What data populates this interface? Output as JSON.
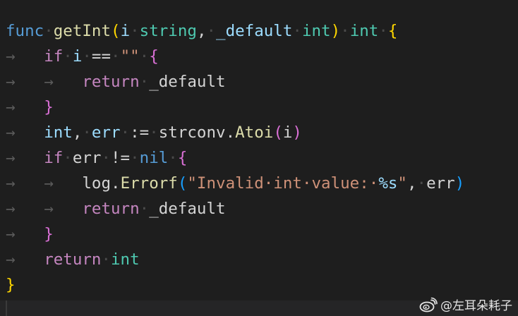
{
  "code": {
    "language": "go",
    "lines": [
      [
        {
          "t": "func",
          "c": "kw-func"
        },
        {
          "t": "·",
          "c": "ws"
        },
        {
          "t": "getInt",
          "c": "fn"
        },
        {
          "t": "(",
          "c": "brace-y"
        },
        {
          "t": "i",
          "c": "param"
        },
        {
          "t": "·",
          "c": "ws"
        },
        {
          "t": "string",
          "c": "type"
        },
        {
          "t": ",",
          "c": "punct"
        },
        {
          "t": "·",
          "c": "ws"
        },
        {
          "t": "_default",
          "c": "param"
        },
        {
          "t": "·",
          "c": "ws"
        },
        {
          "t": "int",
          "c": "type"
        },
        {
          "t": ")",
          "c": "brace-y"
        },
        {
          "t": "·",
          "c": "ws"
        },
        {
          "t": "int",
          "c": "type"
        },
        {
          "t": "·",
          "c": "ws"
        },
        {
          "t": "{",
          "c": "brace-y"
        }
      ],
      [
        {
          "t": "→   ",
          "c": "ind"
        },
        {
          "t": "if",
          "c": "ctrl"
        },
        {
          "t": "·",
          "c": "ws"
        },
        {
          "t": "i",
          "c": "param"
        },
        {
          "t": "·",
          "c": "ws"
        },
        {
          "t": "==",
          "c": "op"
        },
        {
          "t": "·",
          "c": "ws"
        },
        {
          "t": "\"\"",
          "c": "str"
        },
        {
          "t": "·",
          "c": "ws"
        },
        {
          "t": "{",
          "c": "brace-p"
        }
      ],
      [
        {
          "t": "→   ",
          "c": "ind"
        },
        {
          "t": "→   ",
          "c": "ind"
        },
        {
          "t": "return",
          "c": "ctrl"
        },
        {
          "t": "·",
          "c": "ws"
        },
        {
          "t": "_default",
          "c": "plain"
        }
      ],
      [
        {
          "t": "→   ",
          "c": "ind"
        },
        {
          "t": "}",
          "c": "brace-p"
        }
      ],
      [
        {
          "t": "→   ",
          "c": "ind"
        },
        {
          "t": "int",
          "c": "param"
        },
        {
          "t": ",",
          "c": "punct"
        },
        {
          "t": "·",
          "c": "ws"
        },
        {
          "t": "err",
          "c": "param"
        },
        {
          "t": "·",
          "c": "ws"
        },
        {
          "t": ":=",
          "c": "op"
        },
        {
          "t": "·",
          "c": "ws"
        },
        {
          "t": "strconv",
          "c": "plain"
        },
        {
          "t": ".",
          "c": "punct"
        },
        {
          "t": "Atoi",
          "c": "fn"
        },
        {
          "t": "(",
          "c": "brace-p"
        },
        {
          "t": "i",
          "c": "plain"
        },
        {
          "t": ")",
          "c": "brace-p"
        }
      ],
      [
        {
          "t": "→   ",
          "c": "ind"
        },
        {
          "t": "if",
          "c": "ctrl"
        },
        {
          "t": "·",
          "c": "ws"
        },
        {
          "t": "err",
          "c": "plain"
        },
        {
          "t": "·",
          "c": "ws"
        },
        {
          "t": "!=",
          "c": "op"
        },
        {
          "t": "·",
          "c": "ws"
        },
        {
          "t": "nil",
          "c": "lit"
        },
        {
          "t": "·",
          "c": "ws"
        },
        {
          "t": "{",
          "c": "brace-p"
        }
      ],
      [
        {
          "t": "→   ",
          "c": "ind"
        },
        {
          "t": "→   ",
          "c": "ind"
        },
        {
          "t": "log",
          "c": "plain"
        },
        {
          "t": ".",
          "c": "punct"
        },
        {
          "t": "Errorf",
          "c": "fn"
        },
        {
          "t": "(",
          "c": "brace-b"
        },
        {
          "t": "\"Invalid·int·value:·",
          "c": "str"
        },
        {
          "t": "%s",
          "c": "esc"
        },
        {
          "t": "\"",
          "c": "str"
        },
        {
          "t": ",",
          "c": "punct"
        },
        {
          "t": "·",
          "c": "ws"
        },
        {
          "t": "err",
          "c": "plain"
        },
        {
          "t": ")",
          "c": "brace-b"
        }
      ],
      [
        {
          "t": "→   ",
          "c": "ind"
        },
        {
          "t": "→   ",
          "c": "ind"
        },
        {
          "t": "return",
          "c": "ctrl"
        },
        {
          "t": "·",
          "c": "ws"
        },
        {
          "t": "_default",
          "c": "plain"
        }
      ],
      [
        {
          "t": "→   ",
          "c": "ind"
        },
        {
          "t": "}",
          "c": "brace-p"
        }
      ],
      [
        {
          "t": "→   ",
          "c": "ind"
        },
        {
          "t": "return",
          "c": "ctrl"
        },
        {
          "t": "·",
          "c": "ws"
        },
        {
          "t": "int",
          "c": "type"
        }
      ],
      [
        {
          "t": "}",
          "c": "brace-y"
        }
      ]
    ]
  },
  "watermark": {
    "text": "@左耳朵耗子",
    "icon": "weibo-icon"
  },
  "colors": {
    "background": "#1e1e1e",
    "keyword": "#569cd6",
    "control": "#c586c0",
    "function": "#dcdcaa",
    "type": "#4ec9b0",
    "string": "#ce9178"
  }
}
